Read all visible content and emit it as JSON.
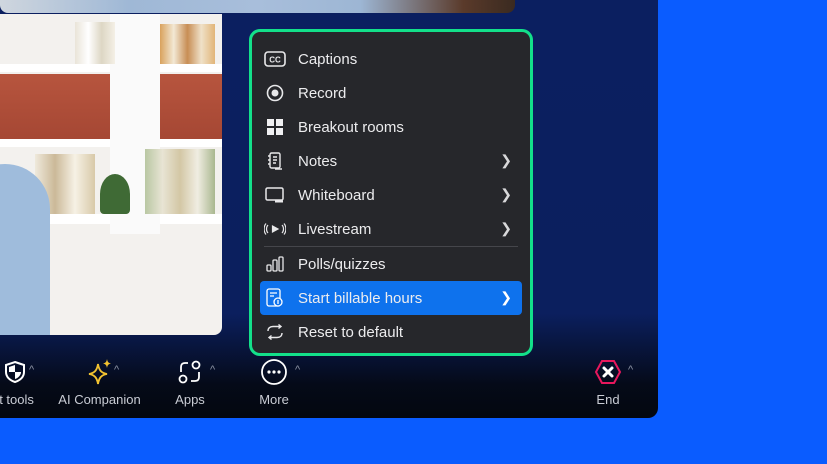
{
  "menu": {
    "items": [
      {
        "label": "Captions",
        "icon": "captions-icon",
        "submenu": false
      },
      {
        "label": "Record",
        "icon": "record-icon",
        "submenu": false
      },
      {
        "label": "Breakout rooms",
        "icon": "breakout-rooms-icon",
        "submenu": false
      },
      {
        "label": "Notes",
        "icon": "notes-icon",
        "submenu": true
      },
      {
        "label": "Whiteboard",
        "icon": "whiteboard-icon",
        "submenu": true
      },
      {
        "label": "Livestream",
        "icon": "livestream-icon",
        "submenu": true
      },
      {
        "label": "Polls/quizzes",
        "icon": "polls-icon",
        "submenu": false
      },
      {
        "label": "Start billable hours",
        "icon": "billable-hours-icon",
        "submenu": true,
        "highlighted": true
      },
      {
        "label": "Reset to default",
        "icon": "reset-icon",
        "submenu": false
      }
    ]
  },
  "toolbar": {
    "host_tools": "Host tools",
    "ai_companion": "AI Companion",
    "apps": "Apps",
    "more": "More",
    "end": "End"
  },
  "colors": {
    "accent": "#0e72ed",
    "highlight_border": "#13e08a",
    "end": "#e8175d",
    "background": "#0a5cff"
  }
}
